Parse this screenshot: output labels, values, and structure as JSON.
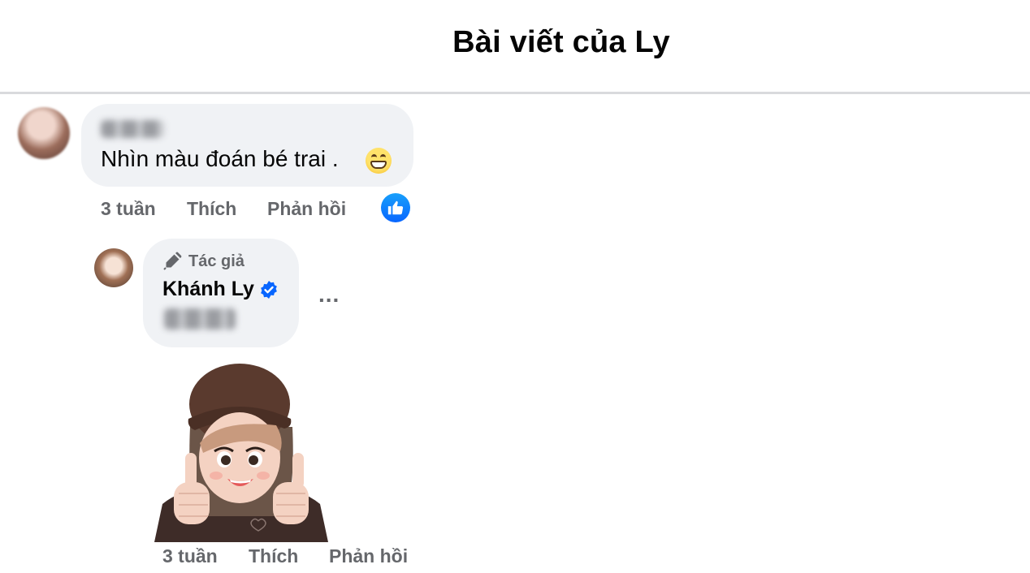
{
  "header": {
    "title": "Bài viết của Ly"
  },
  "comment": {
    "text": "Nhìn màu đoán bé trai .",
    "emoji": "grinning-face",
    "time": "3 tuần",
    "like_label": "Thích",
    "reply_label": "Phản hồi",
    "reaction": "like"
  },
  "reply": {
    "author_badge": "Tác giả",
    "author_name": "Khánh Ly",
    "verified": true,
    "more_label": "...",
    "sticker": "avatar-thumbs-up-sticker",
    "time": "3 tuần",
    "like_label": "Thích",
    "reply_label": "Phản hồi"
  },
  "colors": {
    "bubble_bg": "#f0f2f5",
    "meta_text": "#65676b",
    "like_blue": "#0866ff"
  }
}
